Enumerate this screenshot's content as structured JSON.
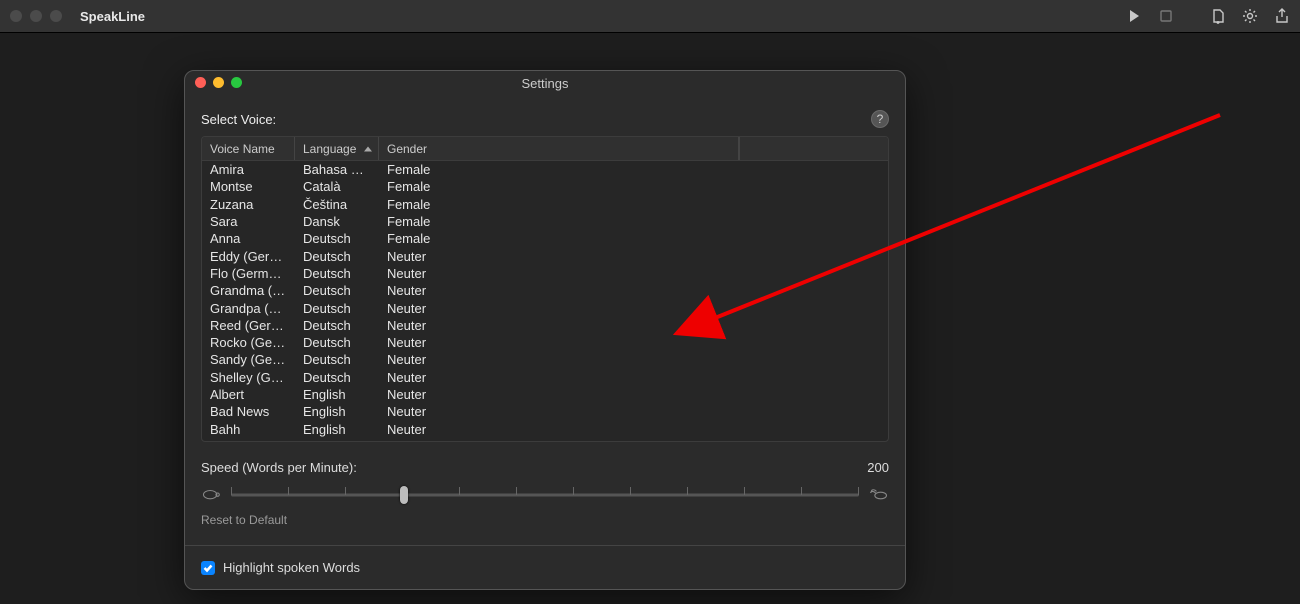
{
  "toolbar": {
    "app_title": "SpeakLine"
  },
  "settings": {
    "title": "Settings",
    "select_label": "Select Voice:",
    "columns": {
      "name": "Voice Name",
      "language": "Language",
      "gender": "Gender"
    },
    "voices": [
      {
        "name": "Amira",
        "language": "Bahasa Mel…",
        "gender": "Female"
      },
      {
        "name": "Montse",
        "language": "Català",
        "gender": "Female"
      },
      {
        "name": "Zuzana",
        "language": "Čeština",
        "gender": "Female"
      },
      {
        "name": "Sara",
        "language": "Dansk",
        "gender": "Female"
      },
      {
        "name": "Anna",
        "language": "Deutsch",
        "gender": "Female"
      },
      {
        "name": "Eddy (Germa…",
        "language": "Deutsch",
        "gender": "Neuter"
      },
      {
        "name": "Flo (German (…",
        "language": "Deutsch",
        "gender": "Neuter"
      },
      {
        "name": "Grandma (Ge…",
        "language": "Deutsch",
        "gender": "Neuter"
      },
      {
        "name": "Grandpa (Ge…",
        "language": "Deutsch",
        "gender": "Neuter"
      },
      {
        "name": "Reed (Germa…",
        "language": "Deutsch",
        "gender": "Neuter"
      },
      {
        "name": "Rocko (Germ…",
        "language": "Deutsch",
        "gender": "Neuter"
      },
      {
        "name": "Sandy (Germ…",
        "language": "Deutsch",
        "gender": "Neuter"
      },
      {
        "name": "Shelley (Ger…",
        "language": "Deutsch",
        "gender": "Neuter"
      },
      {
        "name": "Albert",
        "language": "English",
        "gender": "Neuter"
      },
      {
        "name": "Bad News",
        "language": "English",
        "gender": "Neuter"
      },
      {
        "name": "Bahh",
        "language": "English",
        "gender": "Neuter"
      }
    ],
    "speed_label": "Speed (Words per Minute):",
    "speed_value": "200",
    "reset_label": "Reset to Default",
    "highlight_label": "Highlight spoken Words"
  }
}
